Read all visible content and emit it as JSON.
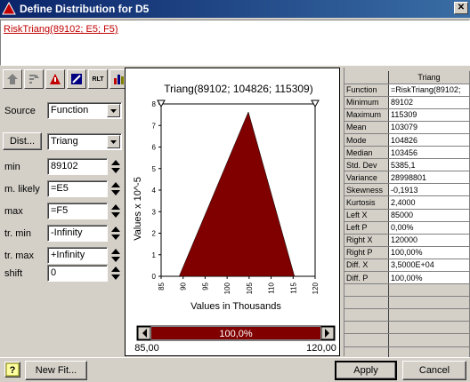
{
  "window": {
    "title": "Define Distribution for D5"
  },
  "formula": {
    "text": "RiskTriang(89102; E5; F5)"
  },
  "toolbar": {
    "buttons": [
      {
        "name": "move-up-icon",
        "glyph": "⇧"
      },
      {
        "name": "sort-icon",
        "glyph": "⇅"
      },
      {
        "name": "warning-icon",
        "glyph": "▲"
      },
      {
        "name": "fit-icon",
        "glyph": "▣"
      },
      {
        "name": "rlt-icon",
        "glyph": "RLT"
      },
      {
        "name": "bar-chart-icon",
        "glyph": "▇"
      }
    ]
  },
  "form": {
    "source_label": "Source",
    "source_value": "Function",
    "dist_button": "Dist...",
    "dist_value": "Triang",
    "min_label": "min",
    "min_value": "89102",
    "mlikely_label": "m. likely",
    "mlikely_value": "=E5",
    "max_label": "max",
    "max_value": "=F5",
    "trmin_label": "tr. min",
    "trmin_value": "-Infinity",
    "trmax_label": "tr. max",
    "trmax_value": "+Infinity",
    "shift_label": "shift",
    "shift_value": "0"
  },
  "chart_data": {
    "type": "area",
    "title": "Triang(89102; 104826; 115309)",
    "xlabel": "Values in Thousands",
    "ylabel": "Values x 10^-5",
    "x": [
      89.102,
      104.826,
      115.309
    ],
    "y": [
      0,
      7.63,
      0
    ],
    "xlim": [
      85,
      120
    ],
    "ylim": [
      0,
      8
    ],
    "xticks": [
      "85",
      "90",
      "95",
      "100",
      "105",
      "110",
      "115",
      "120"
    ],
    "yticks": [
      "0",
      "1",
      "2",
      "3",
      "4",
      "5",
      "6",
      "7",
      "8"
    ],
    "fill_color": "#800000",
    "slider": {
      "left": "85,00",
      "right": "120,00",
      "percent": "100,0%"
    }
  },
  "stats": {
    "header": "Triang",
    "rows": [
      {
        "label": "Function",
        "value": "=RiskTriang(89102;"
      },
      {
        "label": "Minimum",
        "value": "89102"
      },
      {
        "label": "Maximum",
        "value": "115309"
      },
      {
        "label": "Mean",
        "value": "103079"
      },
      {
        "label": "Mode",
        "value": "104826"
      },
      {
        "label": "Median",
        "value": "103456"
      },
      {
        "label": "Std. Dev",
        "value": "5385,1"
      },
      {
        "label": "Variance",
        "value": "28998801"
      },
      {
        "label": "Skewness",
        "value": "-0,1913"
      },
      {
        "label": "Kurtosis",
        "value": "2,4000"
      },
      {
        "label": "Left X",
        "value": "85000"
      },
      {
        "label": "Left P",
        "value": "0,00%"
      },
      {
        "label": "Right X",
        "value": "120000"
      },
      {
        "label": "Right P",
        "value": "100,00%"
      },
      {
        "label": "Diff. X",
        "value": "3,5000E+04"
      },
      {
        "label": "Diff. P",
        "value": "100,00%"
      },
      {
        "label": "",
        "value": ""
      },
      {
        "label": "",
        "value": ""
      },
      {
        "label": "",
        "value": ""
      },
      {
        "label": "",
        "value": ""
      },
      {
        "label": "",
        "value": ""
      },
      {
        "label": "",
        "value": ""
      }
    ]
  },
  "buttons": {
    "help": "?",
    "newfit": "New Fit...",
    "apply": "Apply",
    "cancel": "Cancel"
  }
}
